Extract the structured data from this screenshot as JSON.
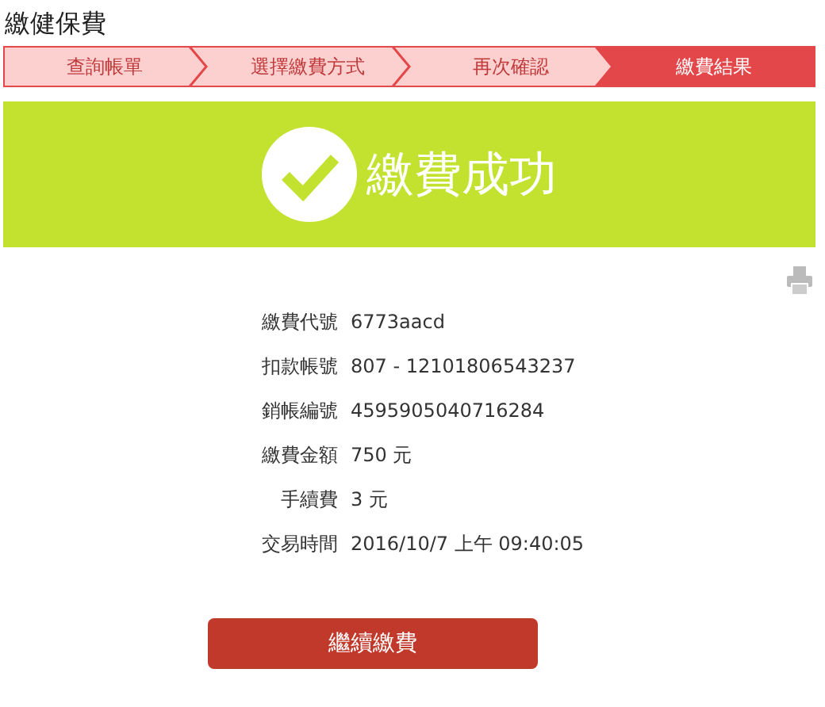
{
  "page_title": "繳健保費",
  "steps": [
    {
      "label": "查詢帳單",
      "selected": false
    },
    {
      "label": "選擇繳費方式",
      "selected": false
    },
    {
      "label": "再次確認",
      "selected": false
    },
    {
      "label": "繳費結果",
      "selected": true
    }
  ],
  "result_banner": {
    "message": "繳費成功"
  },
  "details": [
    {
      "label": "繳費代號",
      "value": "6773aacd"
    },
    {
      "label": "扣款帳號",
      "value": "807 - 12101806543237"
    },
    {
      "label": "銷帳編號",
      "value": "4595905040716284"
    },
    {
      "label": "繳費金額",
      "value": "750 元"
    },
    {
      "label": "手續費",
      "value": "3 元"
    },
    {
      "label": "交易時間",
      "value": "2016/10/7 上午 09:40:05"
    }
  ],
  "continue_button": "繼續繳費"
}
